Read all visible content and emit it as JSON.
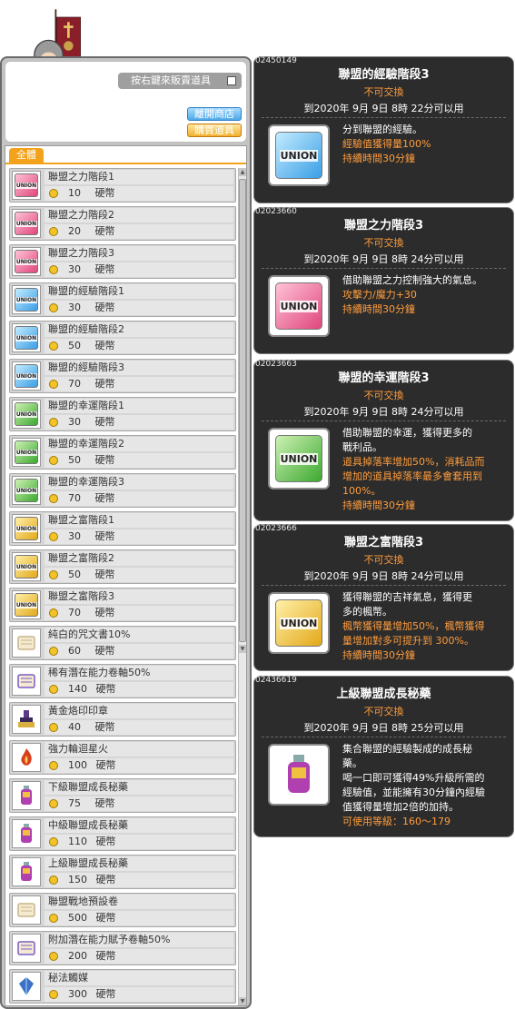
{
  "shop": {
    "sell_hint": "按右鍵來販賣道具",
    "leave_label": "離開商店",
    "buy_label": "購買道具",
    "tab_label": "全體",
    "currency": "硬幣",
    "items": [
      {
        "name": "聯盟之力階段1",
        "price": "10",
        "icon": "union-pink"
      },
      {
        "name": "聯盟之力階段2",
        "price": "20",
        "icon": "union-pink"
      },
      {
        "name": "聯盟之力階段3",
        "price": "30",
        "icon": "union-pink"
      },
      {
        "name": "聯盟的經驗階段1",
        "price": "30",
        "icon": "union-blue"
      },
      {
        "name": "聯盟的經驗階段2",
        "price": "50",
        "icon": "union-blue"
      },
      {
        "name": "聯盟的經驗階段3",
        "price": "70",
        "icon": "union-blue"
      },
      {
        "name": "聯盟的幸運階段1",
        "price": "30",
        "icon": "union-green"
      },
      {
        "name": "聯盟的幸運階段2",
        "price": "50",
        "icon": "union-green"
      },
      {
        "name": "聯盟的幸運階段3",
        "price": "70",
        "icon": "union-green"
      },
      {
        "name": "聯盟之富階段1",
        "price": "30",
        "icon": "union-gold"
      },
      {
        "name": "聯盟之富階段2",
        "price": "50",
        "icon": "union-gold"
      },
      {
        "name": "聯盟之富階段3",
        "price": "70",
        "icon": "union-gold"
      },
      {
        "name": "純白的咒文書10%",
        "price": "60",
        "icon": "scroll-icon"
      },
      {
        "name": "稀有潛在能力卷軸50%",
        "price": "140",
        "icon": "potential-scroll-icon"
      },
      {
        "name": "黃金烙印印章",
        "price": "40",
        "icon": "stamp-icon"
      },
      {
        "name": "強力輪迴星火",
        "price": "100",
        "icon": "flame-icon"
      },
      {
        "name": "下級聯盟成長秘藥",
        "price": "75",
        "icon": "potion-icon"
      },
      {
        "name": "中級聯盟成長秘藥",
        "price": "110",
        "icon": "potion-icon"
      },
      {
        "name": "上級聯盟成長秘藥",
        "price": "150",
        "icon": "potion-icon"
      },
      {
        "name": "聯盟戰地預設卷",
        "price": "500",
        "icon": "scroll-icon"
      },
      {
        "name": "附加潛在能力賦予卷軸50%",
        "price": "200",
        "icon": "potential-scroll-icon"
      },
      {
        "name": "秘法觸媒",
        "price": "300",
        "icon": "catalyst-icon"
      }
    ]
  },
  "union_text": "UNION",
  "tooltips": [
    {
      "id": "02450149",
      "title": "聯盟的經驗階段3",
      "trade": "不可交換",
      "expiry": "到2020年 9月 9日 8時 22分可以用",
      "icon": "union-blue",
      "desc": [
        {
          "text": "分到聯盟的經驗。",
          "color": "white"
        },
        {
          "text": "經驗值獲得量100%",
          "color": "orange"
        },
        {
          "text": "持續時間30分鐘",
          "color": "orange"
        }
      ]
    },
    {
      "id": "02023660",
      "title": "聯盟之力階段3",
      "trade": "不可交換",
      "expiry": "到2020年 9月 9日 8時 24分可以用",
      "icon": "union-pink",
      "desc": [
        {
          "text": "借助聯盟之力控制強大的氣息。",
          "color": "white"
        },
        {
          "text": "攻擊力/魔力+30",
          "color": "orange"
        },
        {
          "text": "持續時間30分鐘",
          "color": "orange"
        }
      ]
    },
    {
      "id": "02023663",
      "title": "聯盟的幸運階段3",
      "trade": "不可交換",
      "expiry": "到2020年 9月 9日 8時 24分可以用",
      "icon": "union-green",
      "desc": [
        {
          "text": "借助聯盟的幸運，獲得更多的",
          "color": "white"
        },
        {
          "text": "戰利品。",
          "color": "white"
        },
        {
          "text": "道具掉落率增加50%，消耗品而",
          "color": "orange"
        },
        {
          "text": "增加的道具掉落率最多會套用到",
          "color": "orange"
        },
        {
          "text": "100%。",
          "color": "orange"
        },
        {
          "text": "持續時間30分鐘",
          "color": "orange"
        }
      ]
    },
    {
      "id": "02023666",
      "title": "聯盟之富階段3",
      "trade": "不可交換",
      "expiry": "到2020年 9月 9日 8時 24分可以用",
      "icon": "union-gold",
      "desc": [
        {
          "text": "獲得聯盟的吉祥氣息，獲得更",
          "color": "white"
        },
        {
          "text": "多的楓幣。",
          "color": "white"
        },
        {
          "text": "楓幣獲得量增加50%，楓幣獲得",
          "color": "orange"
        },
        {
          "text": "量增加對多可提升到 300%。",
          "color": "orange"
        },
        {
          "text": "持續時間30分鐘",
          "color": "orange"
        }
      ]
    },
    {
      "id": "02436619",
      "title": "上級聯盟成長秘藥",
      "trade": "不可交換",
      "expiry": "到2020年 9月 9日 8時 25分可以用",
      "icon": "potion-icon",
      "desc": [
        {
          "text": "集合聯盟的經驗製成的成長秘",
          "color": "white"
        },
        {
          "text": "藥。",
          "color": "white"
        },
        {
          "text": "喝一口即可獲得49%升級所需的",
          "color": "mixed1"
        },
        {
          "text": "經驗值，並能擁有30分鐘內經驗",
          "color": "mixed2"
        },
        {
          "text": "值獲得量增加2倍的加持。",
          "color": "white"
        },
        {
          "text": "可使用等級：160～179",
          "color": "orange"
        }
      ]
    }
  ]
}
